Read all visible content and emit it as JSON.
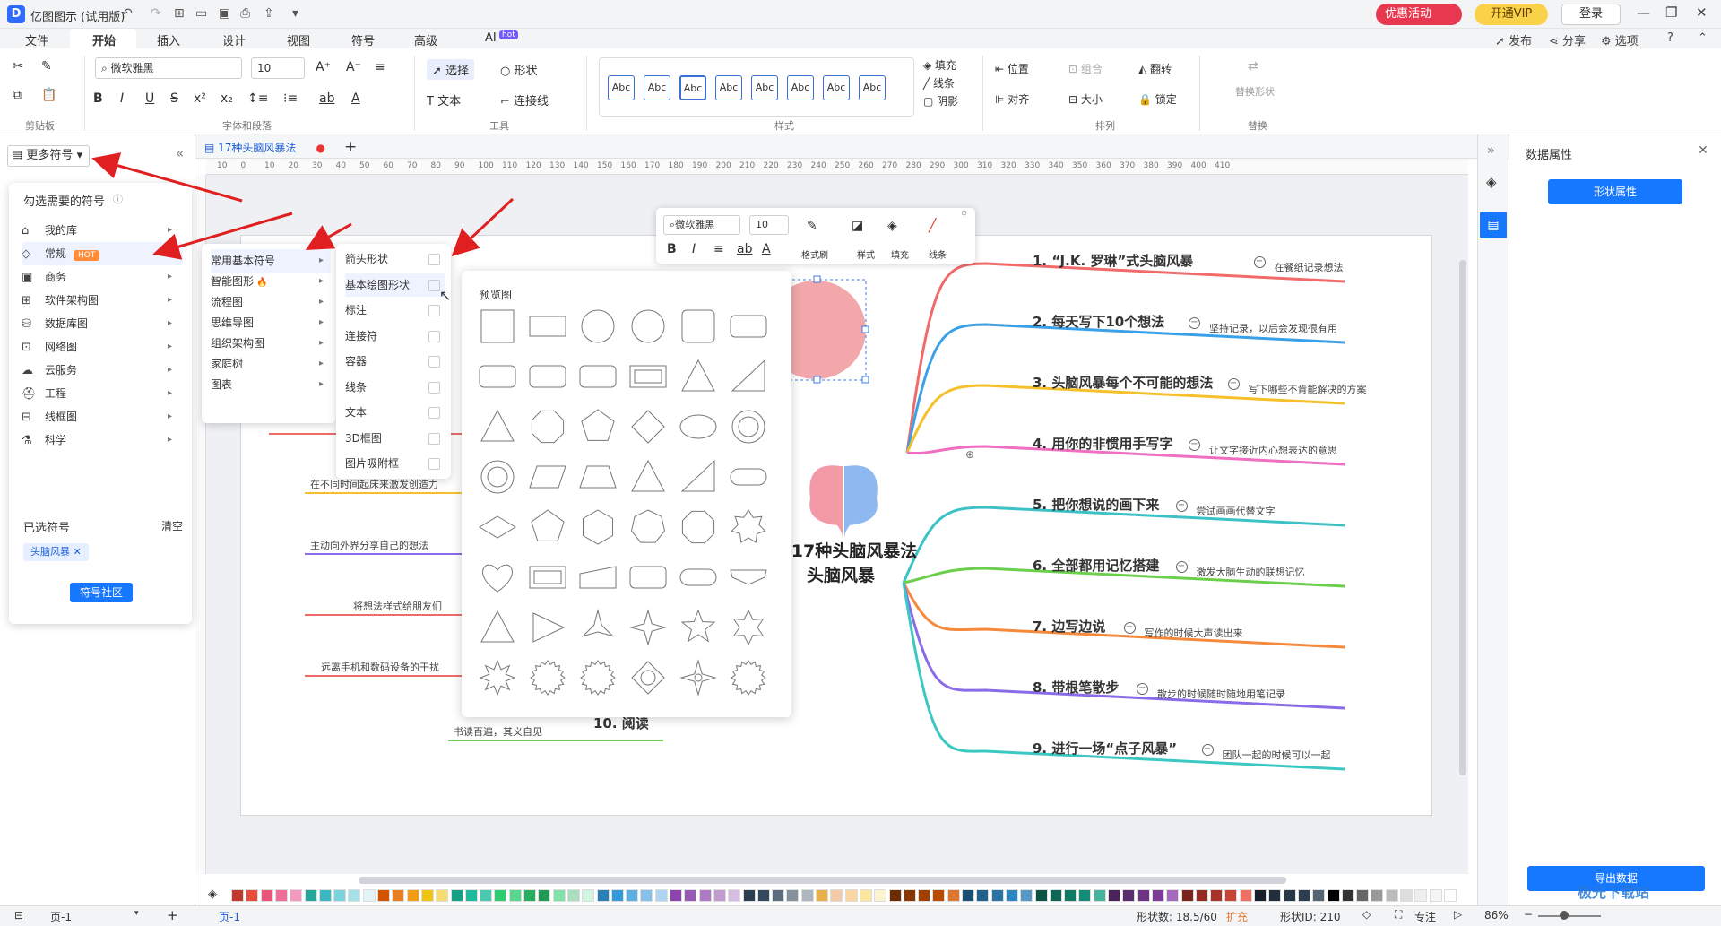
{
  "app": {
    "title": "亿图图示 (试用版)",
    "logo": "D"
  },
  "titlebar": {
    "promo": "优惠活动",
    "vip": "开通VIP",
    "login": "登录"
  },
  "menu": {
    "items": [
      "文件",
      "开始",
      "插入",
      "设计",
      "视图",
      "符号",
      "高级",
      "AI"
    ],
    "active": "开始",
    "ai_badge": "hot",
    "right": [
      "发布",
      "分享",
      "选项"
    ]
  },
  "ribbon": {
    "font_name": "微软雅黑",
    "font_size": "10",
    "groups": [
      "剪贴板",
      "字体和段落",
      "工具",
      "样式",
      "排列",
      "替换"
    ],
    "tools": {
      "select": "选择",
      "shape": "形状",
      "text": "文本",
      "connector": "连接线"
    },
    "style_label": "Abc",
    "fill": "填充",
    "line": "线条",
    "shadow": "阴影",
    "position": "位置",
    "group": "组合",
    "flip": "翻转",
    "align": "对齐",
    "size": "大小",
    "lock": "锁定",
    "replace_shape": "替换形状"
  },
  "doc": {
    "tab": "17种头脑风暴法"
  },
  "ruler": {
    "h": [
      "10",
      "0",
      "10",
      "20",
      "30",
      "40",
      "50",
      "60",
      "70",
      "80",
      "90",
      "100",
      "110",
      "120",
      "130",
      "140",
      "150",
      "160",
      "170",
      "180",
      "190",
      "200",
      "210",
      "220",
      "230",
      "240",
      "250",
      "260",
      "270",
      "280",
      "290",
      "300",
      "310",
      "320",
      "330",
      "340",
      "350",
      "360",
      "370",
      "380",
      "390",
      "400",
      "410"
    ]
  },
  "left_panel": {
    "header": "更多符号",
    "choose_title": "勾选需要的符号",
    "categories": [
      "我的库",
      "常规",
      "商务",
      "软件架构图",
      "数据库图",
      "网络图",
      "云服务",
      "工程",
      "线框图",
      "科学"
    ],
    "hot": "HOT",
    "selected_title": "已选符号",
    "clear": "清空",
    "selected_tag": "头脑风暴",
    "community": "符号社区"
  },
  "submenu": [
    "常用基本符号",
    "智能图形",
    "流程图",
    "思维导图",
    "组织架构图",
    "家庭树",
    "图表"
  ],
  "submenu2": [
    "箭头形状",
    "基本绘图形状",
    "标注",
    "连接符",
    "容器",
    "线条",
    "文本",
    "3D框图",
    "图片吸附框"
  ],
  "preview": {
    "title": "预览图"
  },
  "float_toolbar": {
    "font": "微软雅黑",
    "size": "10",
    "labels": [
      "格式刷",
      "样式",
      "填充",
      "线条"
    ]
  },
  "mindmap": {
    "center": [
      "17种头脑风暴法",
      "头脑风暴"
    ],
    "branches": [
      {
        "title": "1. “J.K. 罗琳”式头脑风暴",
        "note": "在餐纸记录想法",
        "color": "#f06a6a"
      },
      {
        "title": "2. 每天写下10个想法",
        "note": "坚持记录，以后会发现很有用",
        "color": "#3aa0e8"
      },
      {
        "title": "3. 头脑风暴每个不可能的想法",
        "note": "写下哪些不肯能解决的方案",
        "color": "#f5c02b"
      },
      {
        "title": "4. 用你的非惯用手写字",
        "note": "让文字接近内心想表达的意思",
        "color": "#ef6fc0"
      },
      {
        "title": "5. 把你想说的画下来",
        "note": "尝试画画代替文字",
        "color": "#3cc2c6"
      },
      {
        "title": "6. 全部都用记忆搭建",
        "note": "激发大脑生动的联想记忆",
        "color": "#6ccf4c"
      },
      {
        "title": "7. 边写边说",
        "note": "写作的时候大声读出来",
        "color": "#f58a3c"
      },
      {
        "title": "8. 带根笔散步",
        "note": "散步的时候随时随地用笔记录",
        "color": "#8a6ce8"
      },
      {
        "title": "9. 进行一场“点子风暴”",
        "note": "团队一起的时候可以一起",
        "color": "#3cc8c2"
      }
    ],
    "left_notes": [
      "在不同时间起床来激发创造力",
      "主动向外界分享自己的想法",
      "将想法样式给朋友们",
      "远离手机和数码设备的干扰",
      "书读百遍，其义自见"
    ],
    "left_title10": "10. 阅读"
  },
  "right_panel": {
    "title": "数据属性",
    "shape_props": "形状属性",
    "export": "导出数据"
  },
  "statusbar": {
    "page": "页-1",
    "page_tab": "页-1",
    "shape_count": "形状数: 18.5/60",
    "expand": "扩充",
    "shape_id": "形状ID: 210",
    "focus": "专注",
    "zoom": "86%"
  },
  "watermark": "极光下载站",
  "colors": {
    "accent": "#1677ff",
    "brand": "#2f6bff",
    "promo": "#e8384f",
    "vip": "#f9d24a",
    "arrow": "#e02020",
    "brain_left": "#f29ba6",
    "brain_right": "#8eb8f0",
    "circle": "#f2a8ab"
  }
}
